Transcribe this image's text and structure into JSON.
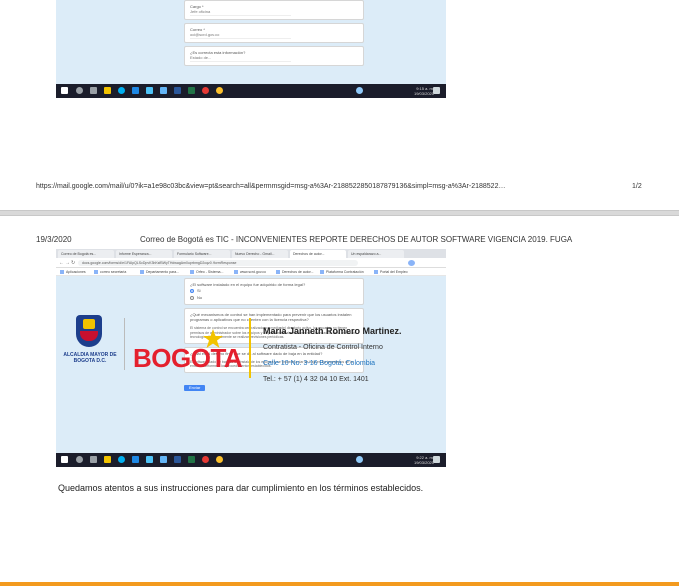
{
  "page1": {
    "form_fields": [
      {
        "label": "Cargo *",
        "value": "Jefe oficina"
      },
      {
        "label": "Correo *",
        "value": "oci@scrd.gov.co"
      },
      {
        "label": "¿Es correcta esta información?",
        "value": "Estado de..."
      }
    ],
    "taskbar_clock": {
      "time": "9:15 a. m.",
      "date": "19/03/2020"
    },
    "url": "https://mail.google.com/mail/u/0?ik=a1e98c03bc&view=pt&search=all&permmsgid=msg-a%3Ar-2188522850187879136&simpl=msg-a%3Ar-2188522…",
    "page_number": "1/2"
  },
  "page2": {
    "date": "19/3/2020",
    "subject": "Correo de Bogotá es TIC - INCONVENIENTES REPORTE DERECHOS DE AUTOR SOFTWARE VIGENCIA 2019. FUGA",
    "browser": {
      "tabs": [
        "Correo de Bogotá es...",
        "Informe Esperanza...",
        "Formulario Software...",
        "Nuevo Derecho - Gmail...",
        "Derechos de autor...",
        "Un espaldarazo a..."
      ],
      "address": "docs.google.com/forms/d/e/1FAIpQLScDpvK3hKsfBWyTHdwagAm0uprbmgD2cqz0 /formResponse",
      "bookmarks": [
        "Aplicaciones",
        "correo secretaria",
        "Departamento para...",
        "Orfeo - Sistema...",
        "www.scrd.gov.co",
        "Derechos de autor...",
        "Plataforma Contratación",
        "Portal del Empleo"
      ]
    },
    "form": {
      "question1": "¿El software instalado en el equipo fue adquirido de forma legal?",
      "option_yes": "Si",
      "option_no": "No",
      "question2": "¿Qué mecanismos de control se han implementado para prevenir que los usuarios instalen programas o aplicativos que no cuenten con la licencia respectiva?",
      "answer2": "El sistema de control se encuentra centralizado por medio del directorio activo, los usuarios no tienen permisos de administrador sobre los equipos y no pueden instalar software sin autorización de la oficina de tecnología. Adicionalmente se realizan revisiones periódicas.",
      "question3": "¿Cuál es el destino final que se da al software dado de baja en la entidad?",
      "answer3": "El software dado de baja se desinstala de los equipos y se procede a dar de baja en los inventarios de la entidad conforme a los procedimientos establecidos.",
      "submit_label": "Enviar"
    },
    "taskbar_clock": {
      "time": "9:22 a. m.",
      "date": "19/03/2020"
    },
    "closing_text": "Quedamos atentos a sus instrucciones para dar cumplimiento en los términos establecidos.",
    "signature": {
      "seal_text": "ALCALDIA MAYOR DE BOGOTA D.C.",
      "logo_text": "BOGOTA",
      "name": "Maria Janneth Romero Martinez.",
      "role": "Contratista - Oficina de Control Interno",
      "address": "Calle 10 No. 3-16 Bogotá, Colombia",
      "phone": "Tel.: + 57 (1) 4 32 04 10  Ext. 1401"
    }
  },
  "colors": {
    "screenshot_bg": "#dcecf8",
    "taskbar": "#1b1d2b",
    "bogota_red": "#e4202e",
    "accent_yellow": "#f2c300",
    "footer_orange": "#f39a1e",
    "link_blue": "#1e73be"
  }
}
